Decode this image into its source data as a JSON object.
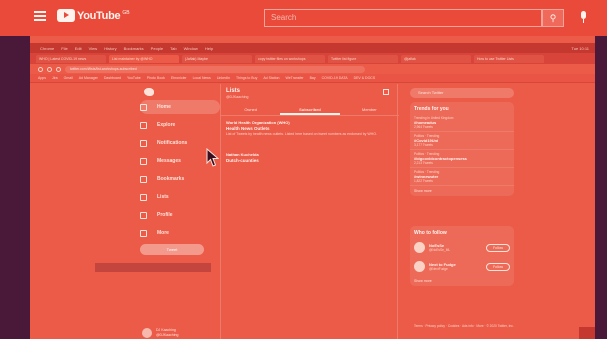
{
  "youtube": {
    "logo_text": "YouTube",
    "logo_sup": "GB",
    "search_placeholder": "Search"
  },
  "browser": {
    "menu": [
      "Chrome",
      "File",
      "Edit",
      "View",
      "History",
      "Bookmarks",
      "People",
      "Tab",
      "Window",
      "Help"
    ],
    "clock": "Tue 10:11",
    "tabs": [
      "WHO | Latest COVID-19 news",
      "List maintainer by @WHO",
      "(Jaflak) Maybe",
      "copy twitter files on workshops",
      "Twitter list figure",
      "@jaflak",
      "How to use Twitter Lists",
      "Lists / Twitter"
    ],
    "url": "twitter.com/i/lists/list-workshops-subscribed",
    "bookmarks": [
      "Apps",
      "Jira",
      "Gmail",
      "Ad Manager",
      "Dashboard",
      "YouTube",
      "Photo Book",
      "Ehronicler",
      "Local News",
      "LinkedIn",
      "Things to Buy",
      "Ad Station",
      "WeTransfer",
      "Bay",
      "COVID-19 DATA",
      "DEV & DOCS",
      "SAFET",
      "LiveMerch"
    ]
  },
  "twitter": {
    "nav": [
      {
        "label": "Home"
      },
      {
        "label": "Explore"
      },
      {
        "label": "Notifications"
      },
      {
        "label": "Messages"
      },
      {
        "label": "Bookmarks"
      },
      {
        "label": "Lists"
      },
      {
        "label": "Profile"
      },
      {
        "label": "More"
      }
    ],
    "tweet_button": "Tweet",
    "profile_name": "DJ Kaaching",
    "profile_handle": "@DJKaaching",
    "main_title": "Lists",
    "main_sub": "@DJKaaching",
    "tabs": [
      "Owned",
      "Subscribed",
      "Member"
    ],
    "lists": [
      {
        "header": "World Health Organization (WHO)",
        "name": "Health News Outlets",
        "desc": "List of Tweets by health news outlets. Listed here based on tweet numbers as endorsed by WHO."
      },
      {
        "header": "Nathan Kuchelda",
        "name": "Dutch-cuunties",
        "desc": ""
      }
    ],
    "search_placeholder": "Search Twitter",
    "trends_title": "Trends for you",
    "trends": [
      {
        "kind": "Trending in United Kingdom",
        "tag": "#homeadus",
        "count": "2,964 Tweets"
      },
      {
        "kind": "Politics · Trending",
        "tag": "#Covid19Uni",
        "count": "3,177 Tweets"
      },
      {
        "kind": "Politics · Trending",
        "tag": "#bigcovidcontractopensess",
        "count": "2,213 Tweets"
      },
      {
        "kind": "Politics · Trending",
        "tag": "#winnewuter",
        "count": "1,822 Tweets"
      }
    ],
    "show_more": "Show more",
    "who_title": "Who to follow",
    "who": [
      {
        "name": "NoEsSe",
        "handle": "@NoEsSe_ML",
        "button": "Follow"
      },
      {
        "name": "Next to Fudge",
        "handle": "@NextFudge",
        "button": "Follow"
      }
    ],
    "footer": "Terms · Privacy policy · Cookies · Ads info · More · © 2020 Twitter, Inc."
  },
  "colors": {
    "overlay": "#ec5a48",
    "frame": "#4a1838"
  }
}
